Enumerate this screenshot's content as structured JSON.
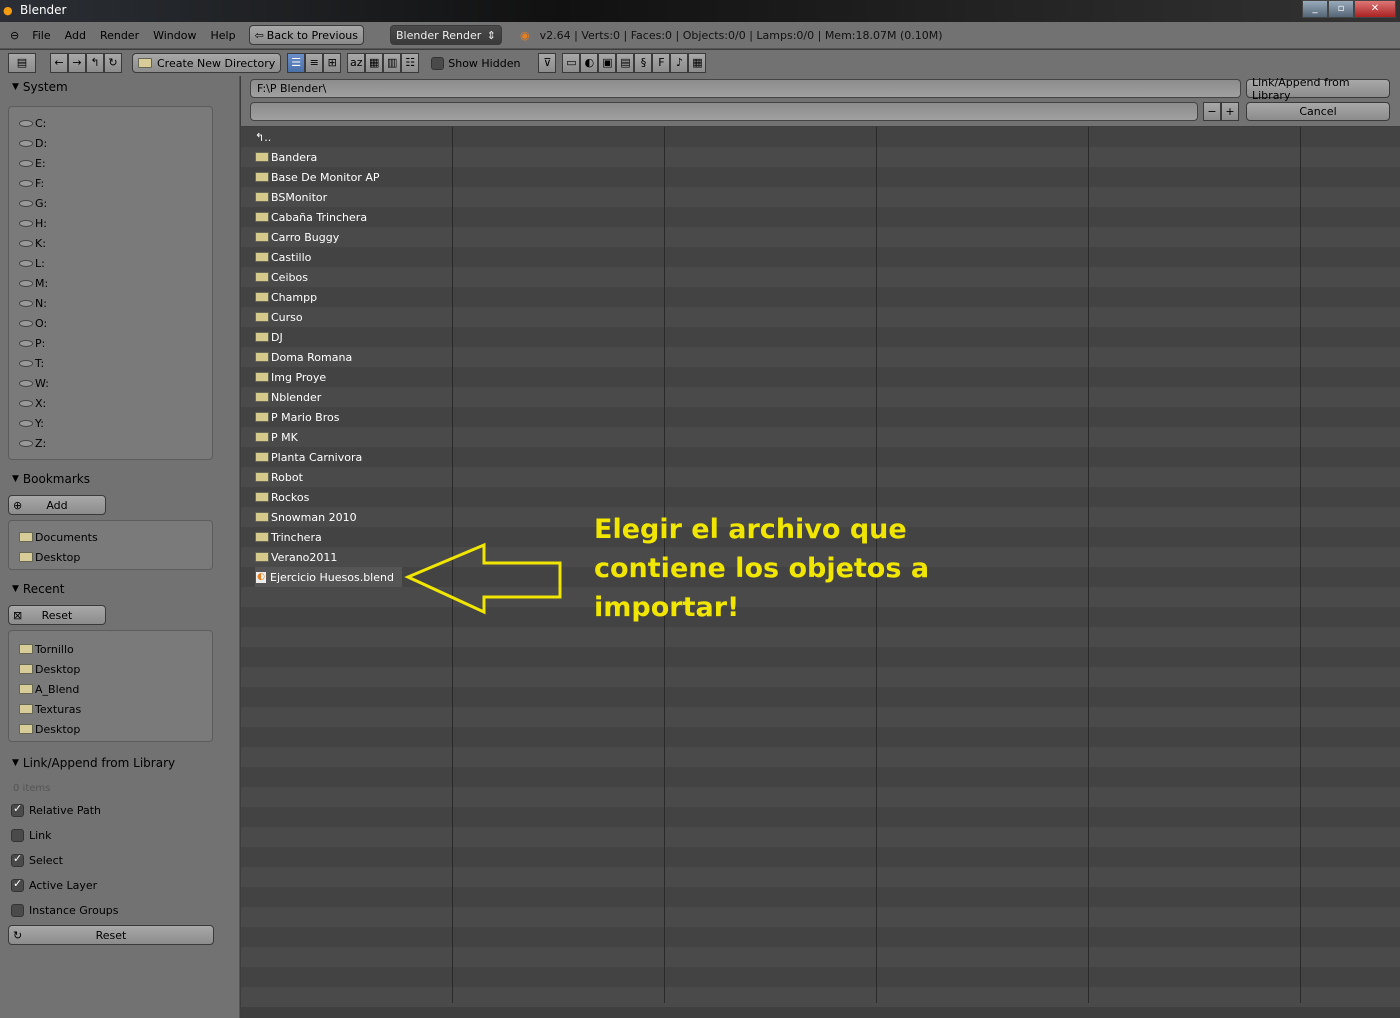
{
  "window": {
    "title": "Blender",
    "buttons": [
      "minimize",
      "restore",
      "close"
    ]
  },
  "menubar": {
    "items": [
      "File",
      "Add",
      "Render",
      "Window",
      "Help"
    ],
    "back_label": "Back to Previous",
    "engine": "Blender Render",
    "stats": "v2.64 | Verts:0 | Faces:0 | Objects:0/0 | Lamps:0/0 | Mem:18.07M (0.10M)"
  },
  "toolbar": {
    "create_dir": "Create New Directory",
    "show_hidden": "Show Hidden",
    "show_hidden_checked": false
  },
  "sidebar": {
    "system": {
      "title": "System",
      "drives": [
        "C:",
        "D:",
        "E:",
        "F:",
        "G:",
        "H:",
        "K:",
        "L:",
        "M:",
        "N:",
        "O:",
        "P:",
        "T:",
        "W:",
        "X:",
        "Y:",
        "Z:"
      ]
    },
    "bookmarks": {
      "title": "Bookmarks",
      "add_label": "Add",
      "items": [
        "Documents",
        "Desktop"
      ]
    },
    "recent": {
      "title": "Recent",
      "reset_label": "Reset",
      "items": [
        "Tornillo",
        "Desktop",
        "A_Blend",
        "Texturas",
        "Desktop"
      ]
    },
    "link": {
      "title": "Link/Append from Library",
      "count": "0 items",
      "options": [
        {
          "label": "Relative Path",
          "checked": true
        },
        {
          "label": "Link",
          "checked": false
        },
        {
          "label": "Select",
          "checked": true
        },
        {
          "label": "Active Layer",
          "checked": true
        },
        {
          "label": "Instance Groups",
          "checked": false
        }
      ],
      "reset_label": "Reset"
    }
  },
  "main": {
    "path": "F:\\P Blender\\",
    "filename": "",
    "action_label": "Link/Append from Library",
    "cancel_label": "Cancel",
    "parent": "..",
    "folders": [
      "Bandera",
      "Base De Monitor AP",
      "BSMonitor",
      "Cabaña Trinchera",
      "Carro  Buggy",
      "Castillo",
      "Ceibos",
      "Champp",
      "Curso",
      "DJ",
      "Doma Romana",
      "Img Proye",
      "Nblender",
      "P Mario Bros",
      "P MK",
      "Planta Carnivora",
      "Robot",
      "Rockos",
      "Snowman 2010",
      "Trinchera",
      "Verano2011"
    ],
    "file": "Ejercicio  Huesos.blend"
  },
  "annotation": {
    "lines": [
      "Elegir el archivo que",
      "contiene los objetos a",
      "importar!"
    ],
    "color": "#f0e600"
  }
}
